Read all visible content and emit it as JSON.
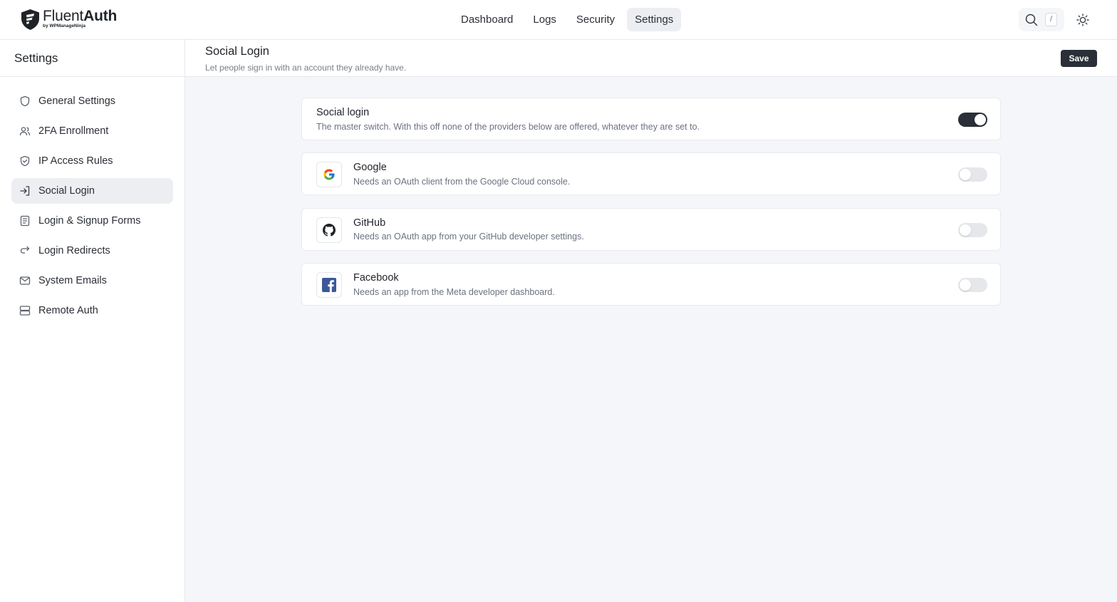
{
  "brand": {
    "name_light": "Fluent",
    "name_bold": "Auth",
    "byline": "by WPManageNinja"
  },
  "nav": {
    "items": [
      {
        "label": "Dashboard"
      },
      {
        "label": "Logs"
      },
      {
        "label": "Security"
      },
      {
        "label": "Settings"
      }
    ],
    "active": "Settings"
  },
  "search": {
    "shortcut": "/"
  },
  "sidebar": {
    "title": "Settings",
    "items": [
      {
        "label": "General Settings",
        "icon": "shield-icon"
      },
      {
        "label": "2FA Enrollment",
        "icon": "users-icon"
      },
      {
        "label": "IP Access Rules",
        "icon": "shield-check-icon"
      },
      {
        "label": "Social Login",
        "icon": "sign-in-icon"
      },
      {
        "label": "Login & Signup Forms",
        "icon": "form-icon"
      },
      {
        "label": "Login Redirects",
        "icon": "redirect-icon"
      },
      {
        "label": "System Emails",
        "icon": "mail-icon"
      },
      {
        "label": "Remote Auth",
        "icon": "server-icon"
      }
    ],
    "active": "Social Login"
  },
  "page": {
    "title": "Social Login",
    "subtitle": "Let people sign in with an account they already have.",
    "save_label": "Save"
  },
  "master": {
    "title": "Social login",
    "description": "The master switch. With this off none of the providers below are offered, whatever they are set to.",
    "enabled": true
  },
  "providers": [
    {
      "name": "Google",
      "description": "Needs an OAuth client from the Google Cloud console.",
      "icon": "google-icon",
      "enabled": false
    },
    {
      "name": "GitHub",
      "description": "Needs an OAuth app from your GitHub developer settings.",
      "icon": "github-icon",
      "enabled": false
    },
    {
      "name": "Facebook",
      "description": "Needs an app from the Meta developer dashboard.",
      "icon": "facebook-icon",
      "enabled": false
    }
  ],
  "colors": {
    "accent": "#2a2f38",
    "facebook": "#3b5998"
  }
}
